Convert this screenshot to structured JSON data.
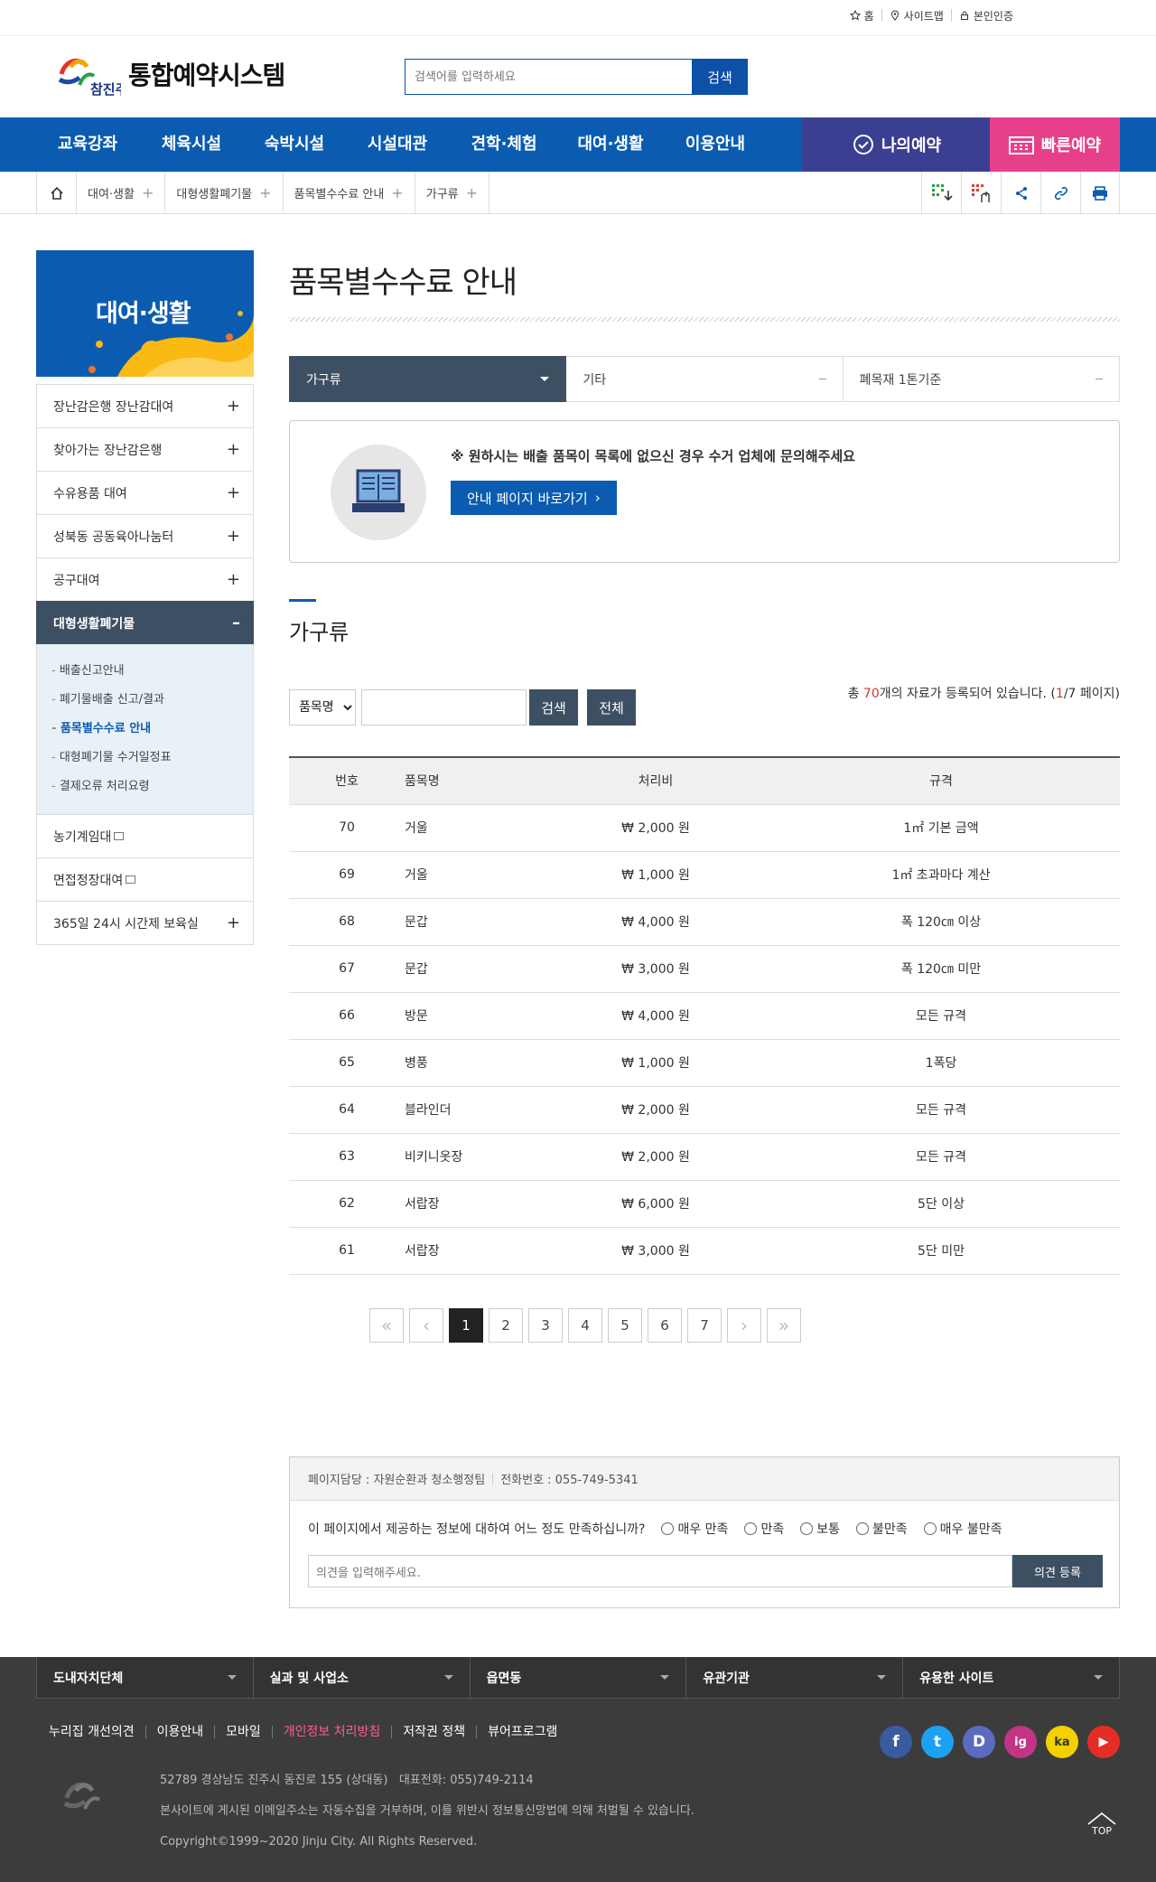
{
  "util": {
    "home": "홈",
    "sitemap": "사이트맵",
    "auth": "본인인증"
  },
  "header": {
    "logo_small": "참진주",
    "title": "통합예약시스템",
    "search_placeholder": "검색어를 입력하세요",
    "search_btn": "검색"
  },
  "gnb": {
    "items": [
      "교육강좌",
      "체육시설",
      "숙박시설",
      "시설대관",
      "견학·체험",
      "대여·생활",
      "이용안내"
    ],
    "my": "나의예약",
    "quick": "빠른예약"
  },
  "location": {
    "crumbs": [
      "대여·생활",
      "대형생활폐기물",
      "품목별수수료 안내",
      "가구류"
    ]
  },
  "side": {
    "title": "대여·생활",
    "items": [
      "장난감은행 장난감대여",
      "찾아가는 장난감은행",
      "수유용품 대여",
      "성북동 공동육아나눔터",
      "공구대여",
      "대형생활폐기물",
      "농기계임대",
      "면접정장대여",
      "365일 24시 시간제 보육실"
    ],
    "sub": [
      "배출신고안내",
      "폐기물배출 신고/결과",
      "품목별수수료 안내",
      "대형폐기물 수거일정표",
      "결제오류 처리요령"
    ]
  },
  "content": {
    "title": "품목별수수료 안내",
    "tabs": [
      "가구류",
      "기타",
      "폐목재 1톤기준"
    ],
    "notice_msg": "※ 원하시는 배출 품목이 목록에 없으신 경우 수거 업체에 문의해주세요",
    "notice_btn": "안내 페이지 바로가기",
    "section": "가구류",
    "select": "품목명",
    "search_btn": "검색",
    "all_btn": "전체",
    "total_pre": "총 ",
    "total_num": "70",
    "total_mid": "개의 자료가 등록되어 있습니다. (",
    "page_cur": "1",
    "total_post": "/7 페이지)"
  },
  "table": {
    "headers": [
      "번호",
      "품목명",
      "처리비",
      "규격"
    ],
    "rows": [
      [
        "70",
        "거울",
        "₩ 2,000 원",
        "1㎡ 기본 금액"
      ],
      [
        "69",
        "거울",
        "₩ 1,000 원",
        "1㎡ 초과마다 계산"
      ],
      [
        "68",
        "문갑",
        "₩ 4,000 원",
        "폭 120㎝ 이상"
      ],
      [
        "67",
        "문갑",
        "₩ 3,000 원",
        "폭 120㎝ 미만"
      ],
      [
        "66",
        "방문",
        "₩ 4,000 원",
        "모든 규격"
      ],
      [
        "65",
        "병풍",
        "₩ 1,000 원",
        "1폭당"
      ],
      [
        "64",
        "블라인더",
        "₩ 2,000 원",
        "모든 규격"
      ],
      [
        "63",
        "비키니옷장",
        "₩ 2,000 원",
        "모든 규격"
      ],
      [
        "62",
        "서랍장",
        "₩ 6,000 원",
        "5단 이상"
      ],
      [
        "61",
        "서랍장",
        "₩ 3,000 원",
        "5단 미만"
      ]
    ]
  },
  "paging": {
    "pages": [
      "1",
      "2",
      "3",
      "4",
      "5",
      "6",
      "7"
    ],
    "first": "«",
    "prev": "‹",
    "next": "›",
    "last": "»"
  },
  "satis": {
    "dept": "페이지담당 : 자원순환과 청소행정팀",
    "tel": "전화번호 : 055-749-5341",
    "question": "이 페이지에서 제공하는 정보에 대하여 어느 정도 만족하십니까?",
    "options": [
      "매우 만족",
      "만족",
      "보통",
      "불만족",
      "매우 불만족"
    ],
    "placeholder": "의견을 입력해주세요.",
    "submit": "의견 등록"
  },
  "footer": {
    "selects": [
      "도내자치단체",
      "실과 및 사업소",
      "읍면동",
      "유관기관",
      "유용한 사이트"
    ],
    "links": [
      "누리집 개선의견",
      "이용안내",
      "모바일",
      "개인정보 처리방침",
      "저작권 정책",
      "뷰어프로그램"
    ],
    "addr": "52789 경상남도 진주시 동진로 155 (상대동)   대표전화: 055)749-2114",
    "email": "본사이트에 게시된 이메일주소는 자동수집을 거부하며, 이를 위반시 정보통신망법에 의해 처벌될 수 있습니다.",
    "copy": "Copyright©1999~2020 Jinju City. All Rights Reserved.",
    "top": "TOP",
    "sns": [
      "f",
      "t",
      "D",
      "ig",
      "ka",
      "▶"
    ]
  },
  "colors": {
    "primary": "#0b5cb0",
    "my": "#3b3f91",
    "quick": "#e6408b",
    "dark": "#3d4f63"
  }
}
